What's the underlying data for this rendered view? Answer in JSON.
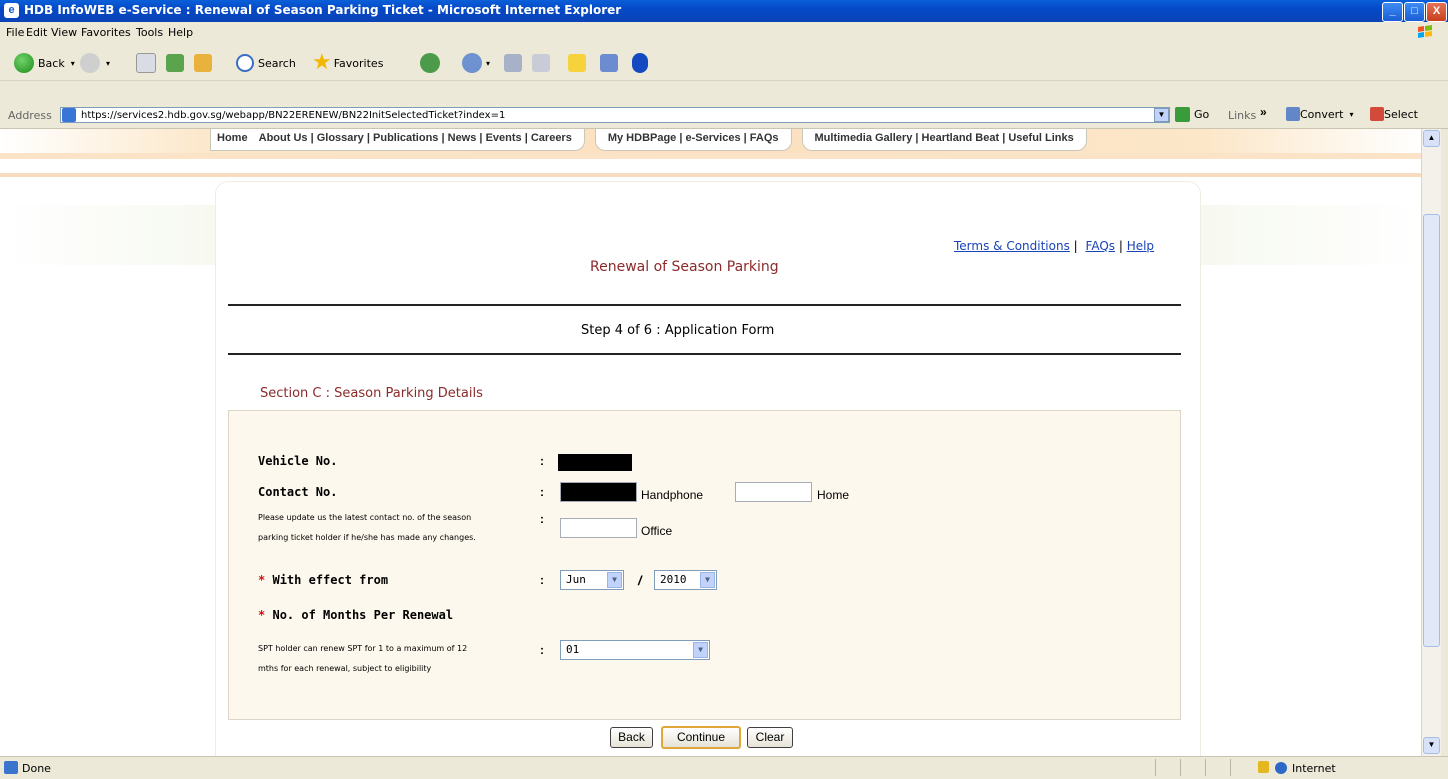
{
  "window": {
    "title": "HDB InfoWEB e-Service : Renewal of Season Parking Ticket - Microsoft Internet Explorer",
    "controls": [
      "_",
      "□",
      "X"
    ]
  },
  "menu": [
    "File",
    "Edit",
    "View",
    "Favorites",
    "Tools",
    "Help"
  ],
  "toolbar": {
    "back": "Back",
    "search": "Search",
    "favorites": "Favorites"
  },
  "address": {
    "label": "Address",
    "url": "https://services2.hdb.gov.sg/webapp/BN22ERENEW/BN22InitSelectedTicket?index=1",
    "go": "Go",
    "links": "Links",
    "convert": "Convert",
    "select": "Select"
  },
  "nav": {
    "tab1": [
      "Home",
      "About Us",
      "Glossary",
      "Publications",
      "News",
      "Events",
      "Careers"
    ],
    "tab2": [
      "My HDBPage",
      "e-Services",
      "FAQs"
    ],
    "tab3": [
      "Multimedia Gallery",
      "Heartland Beat",
      "Useful Links"
    ]
  },
  "top_links": {
    "terms": "Terms & Conditions",
    "faqs": "FAQs",
    "help": "Help"
  },
  "page": {
    "title": "Renewal of Season Parking",
    "step": "Step 4 of 6 : Application Form",
    "section": "Section C : Season Parking Details"
  },
  "form": {
    "vehicle_label": "Vehicle No.",
    "contact_label": "Contact No.",
    "contact_note_line1": "Please update us the latest contact no. of the season",
    "contact_note_line2": "parking ticket holder if he/she has made any changes.",
    "handphone": "Handphone",
    "home": "Home",
    "office": "Office",
    "effect_label": "With effect from",
    "month_value": "Jun",
    "slash": "/",
    "year_value": "2010",
    "months_label": "No. of Months Per Renewal",
    "months_note_line1": "SPT holder can renew SPT for 1 to a maximum of 12",
    "months_note_line2": "mths for each renewal, subject to eligibility",
    "months_value": "01",
    "colon": ":",
    "asterisk": "*"
  },
  "buttons": {
    "back": "Back",
    "continue": "Continue",
    "clear": "Clear"
  },
  "status": {
    "left": "Done",
    "zone": "Internet"
  }
}
